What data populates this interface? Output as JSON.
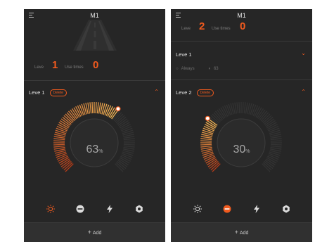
{
  "accent_color": "#f05a1e",
  "screens": [
    {
      "title": "M1",
      "summary": {
        "level_label": "Leve",
        "level_value": "1",
        "use_label": "Use times",
        "use_value": "0"
      },
      "level_title": "Leve 1",
      "delete_label": "Delete",
      "brightness_percent": 63,
      "brightness_value": "63",
      "brightness_unit": "%",
      "active_mode": "brightness",
      "add_label": "Add"
    },
    {
      "title": "M1",
      "summary": {
        "level_label": "Leve",
        "level_value": "2",
        "use_label": "Use times",
        "use_value": "0"
      },
      "collapsed_title": "Leve 1",
      "collapsed_mode": "Always",
      "collapsed_value": "63",
      "level_title": "Leve 2",
      "delete_label": "Delete",
      "brightness_percent": 30,
      "brightness_value": "30",
      "brightness_unit": "%",
      "active_mode": "sos",
      "add_label": "Add"
    }
  ],
  "mode_icons": [
    "sun-icon",
    "sos-icon",
    "lightning-icon",
    "hexagon-icon"
  ],
  "mode_names": [
    "brightness",
    "sos",
    "strobe",
    "beacon"
  ]
}
